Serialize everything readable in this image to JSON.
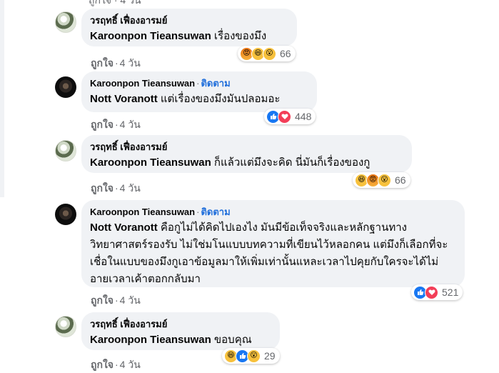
{
  "top_partial": "ถูกใจ · 4 วัน",
  "comments": [
    {
      "author": "วรฤทธิ์ เฟื่องอารมย์",
      "follow": "",
      "mention": "Karoonpon Tieansuwan",
      "text": " เรื่องของมึง",
      "like_label": "ถูกใจ",
      "time": "4 วัน",
      "reactions": [
        "angry-icon",
        "haha-icon",
        "wow-icon"
      ],
      "count": "66"
    },
    {
      "author": "Karoonpon Tieansuwan",
      "follow": "ติดตาม",
      "mention": "Nott Voranott",
      "text": " แต่เรื่องของมึงมันปลอมอะ",
      "like_label": "ถูกใจ",
      "time": "4 วัน",
      "reactions": [
        "like-icon",
        "love-icon"
      ],
      "count": "448"
    },
    {
      "author": "วรฤทธิ์ เฟื่องอารมย์",
      "follow": "",
      "mention": "Karoonpon Tieansuwan",
      "text": " ก็แล้วแต่มึงจะคิด นี่มันก็เรื่องของกู",
      "like_label": "ถูกใจ",
      "time": "4 วัน",
      "reactions": [
        "haha-icon",
        "angry-icon",
        "wow-icon"
      ],
      "count": "66"
    },
    {
      "author": "Karoonpon Tieansuwan",
      "follow": "ติดตาม",
      "mention": "Nott Voranott",
      "text": " คือกูไม่ได้คิดไปเองไง มันมีข้อเท็จจริงและหลักฐานทางวิทยาศาสตร์รองรับ ไม่ใช่มโนแบบบทความที่เขียนไว้หลอกคน แต่มึงก็เลือกที่จะเชื่อในแบบของมึงกูเอาข้อมูลมาให้เพิ่มเท่านั้นแหละเวลาไปคุยกับใครจะได้ไม่อายเวลาเค้าตอกกลับมา",
      "like_label": "ถูกใจ",
      "time": "4 วัน",
      "reactions": [
        "like-icon",
        "love-icon"
      ],
      "count": "521"
    },
    {
      "author": "วรฤทธิ์ เฟื่องอารมย์",
      "follow": "",
      "mention": "Karoonpon Tieansuwan",
      "text": " ขอบคุณ",
      "like_label": "ถูกใจ",
      "time": "4 วัน",
      "reactions": [
        "haha-icon",
        "like-icon",
        "wow-icon"
      ],
      "count": "29"
    }
  ],
  "colors": {
    "bubble": "#f0f2f5",
    "link": "#216fdb",
    "meta": "#65676b",
    "like_blue": "#1877f2",
    "love_red": "#f33e58",
    "yellow": "#f7c13d"
  }
}
